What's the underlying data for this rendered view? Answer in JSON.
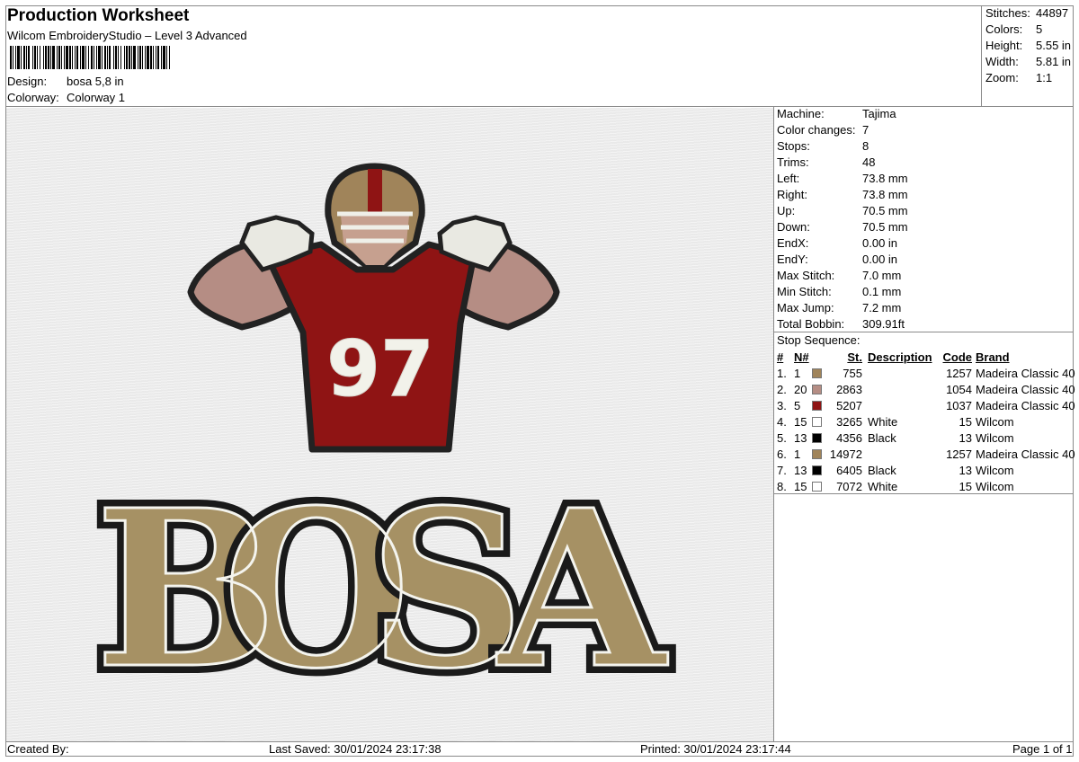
{
  "header": {
    "title": "Production Worksheet",
    "subtitle": "Wilcom EmbroideryStudio – Level 3 Advanced",
    "design_label": "Design:",
    "design_value": "bosa 5,8 in",
    "colorway_label": "Colorway:",
    "colorway_value": "Colorway 1"
  },
  "stats": [
    {
      "label": "Stitches:",
      "value": "44897"
    },
    {
      "label": "Colors:",
      "value": "5"
    },
    {
      "label": "Height:",
      "value": "5.55 in"
    },
    {
      "label": "Width:",
      "value": "5.81 in"
    },
    {
      "label": "Zoom:",
      "value": "1:1"
    }
  ],
  "machine_params": [
    {
      "label": "Machine:",
      "value": "Tajima"
    },
    {
      "label": "Color changes:",
      "value": "7"
    },
    {
      "label": "Stops:",
      "value": "8"
    },
    {
      "label": "Trims:",
      "value": "48"
    },
    {
      "label": "Left:",
      "value": "73.8 mm"
    },
    {
      "label": "Right:",
      "value": "73.8 mm"
    },
    {
      "label": "Up:",
      "value": "70.5 mm"
    },
    {
      "label": "Down:",
      "value": "70.5 mm"
    },
    {
      "label": "EndX:",
      "value": "0.00 in"
    },
    {
      "label": "EndY:",
      "value": "0.00 in"
    },
    {
      "label": "Max Stitch:",
      "value": "7.0 mm"
    },
    {
      "label": "Min Stitch:",
      "value": "0.1 mm"
    },
    {
      "label": "Max Jump:",
      "value": "7.2 mm"
    },
    {
      "label": "Total Bobbin:",
      "value": "309.91ft"
    }
  ],
  "stop_sequence": {
    "title": "Stop Sequence:",
    "columns": [
      "#",
      "N#",
      "St.",
      "Description",
      "Code",
      "Brand"
    ],
    "rows": [
      {
        "idx": "1.",
        "n": "1",
        "color": "#a0845a",
        "st": "755",
        "desc": "",
        "code": "1257",
        "brand": "Madeira Classic 40"
      },
      {
        "idx": "2.",
        "n": "20",
        "color": "#b58d84",
        "st": "2863",
        "desc": "",
        "code": "1054",
        "brand": "Madeira Classic 40"
      },
      {
        "idx": "3.",
        "n": "5",
        "color": "#8f1414",
        "st": "5207",
        "desc": "",
        "code": "1037",
        "brand": "Madeira Classic 40"
      },
      {
        "idx": "4.",
        "n": "15",
        "color": "#ffffff",
        "st": "3265",
        "desc": "White",
        "code": "15",
        "brand": "Wilcom"
      },
      {
        "idx": "5.",
        "n": "13",
        "color": "#000000",
        "st": "4356",
        "desc": "Black",
        "code": "13",
        "brand": "Wilcom"
      },
      {
        "idx": "6.",
        "n": "1",
        "color": "#a0845a",
        "st": "14972",
        "desc": "",
        "code": "1257",
        "brand": "Madeira Classic 40"
      },
      {
        "idx": "7.",
        "n": "13",
        "color": "#000000",
        "st": "6405",
        "desc": "Black",
        "code": "13",
        "brand": "Wilcom"
      },
      {
        "idx": "8.",
        "n": "15",
        "color": "#ffffff",
        "st": "7072",
        "desc": "White",
        "code": "15",
        "brand": "Wilcom"
      }
    ]
  },
  "design_image": {
    "jersey_number": "97",
    "lettering": [
      "B",
      "O",
      "S",
      "A"
    ]
  },
  "footer": {
    "created_by": "Created By:",
    "last_saved": "Last Saved: 30/01/2024 23:17:38",
    "printed": "Printed: 30/01/2024 23:17:44",
    "page": "Page 1 of 1"
  }
}
